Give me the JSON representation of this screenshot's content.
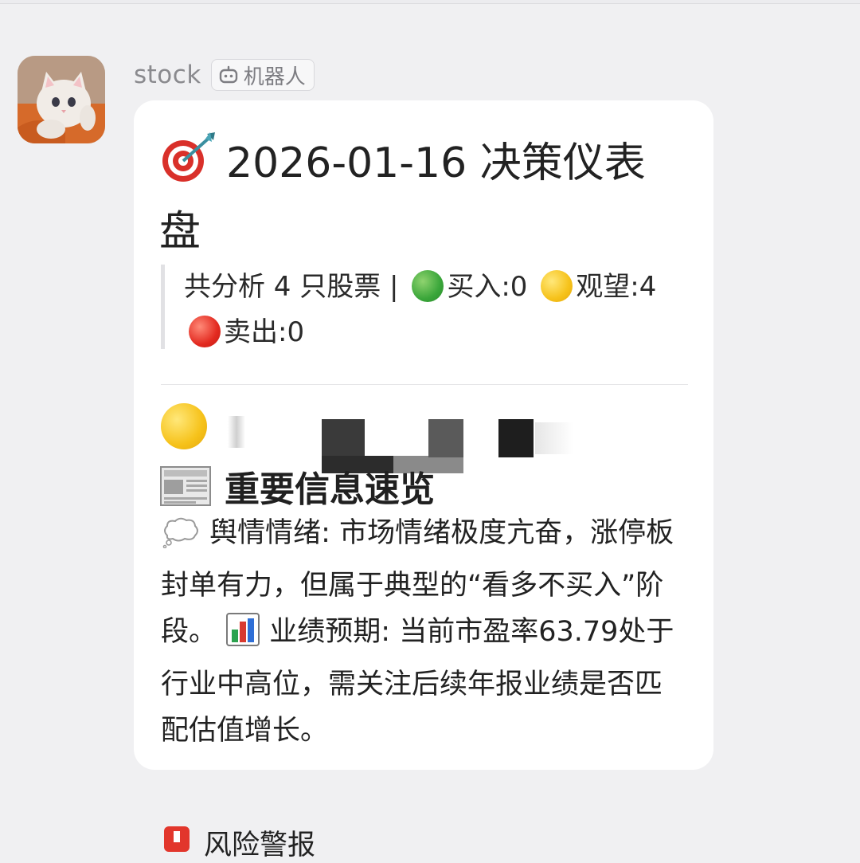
{
  "message": {
    "sender": "stock",
    "badge_label": "机器人"
  },
  "card": {
    "title": "2026-01-16 决策仪表盘",
    "summary": {
      "prefix": "共分析 4 只股票 | ",
      "buy": "买入:0",
      "hold": "观望:4",
      "sell": "卖出:0"
    },
    "section_title": "重要信息速览",
    "sentiment_label": "舆情情绪:",
    "sentiment_text": "市场情绪极度亢奋，涨停板封单有力，但属于典型的“看多不买入”阶段。",
    "earnings_label": "业绩预期:",
    "earnings_text": "当前市盈率63.79处于行业中高位，需关注后续年报业绩是否匹配估值增长。",
    "next_section_partial": "风险警报"
  },
  "colors": {
    "background": "#f0f0f2",
    "card": "#ffffff",
    "muted_text": "#8a8a8e",
    "buy_dot": "#3aa63a",
    "hold_dot": "#f6c21a",
    "sell_dot": "#e32a20"
  },
  "icons": {
    "avatar": "kitten-avatar",
    "badge": "robot-icon",
    "title": "direct-hit-target-icon",
    "section": "newspaper-icon",
    "sentiment": "thought-balloon-icon",
    "earnings": "bar-chart-icon",
    "next_section": "siren-icon"
  }
}
